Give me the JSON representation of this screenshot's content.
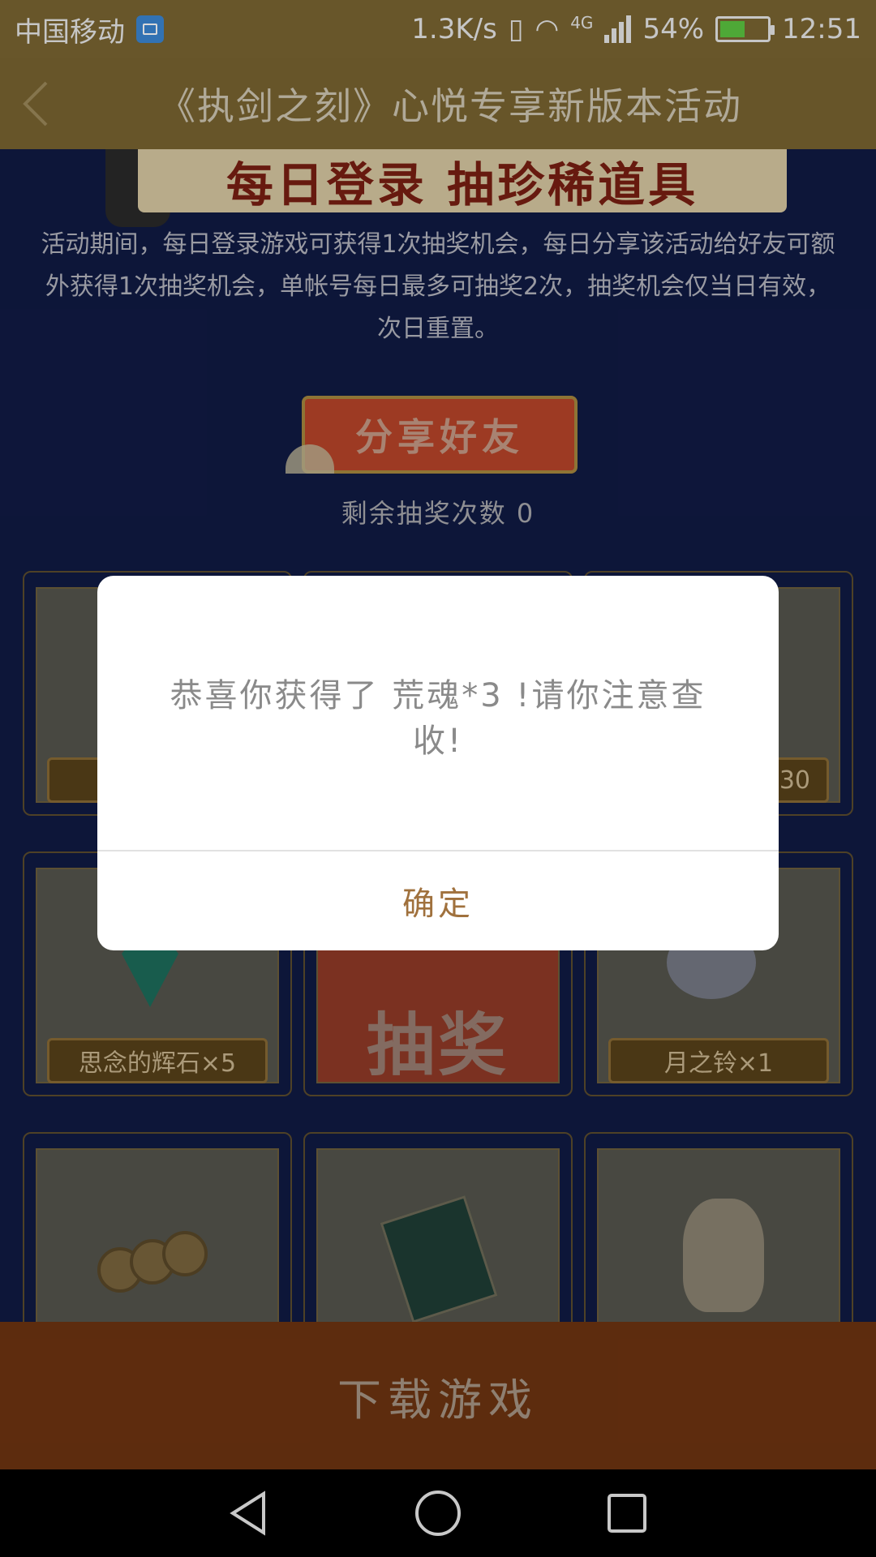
{
  "status_bar": {
    "carrier": "中国移动",
    "speed": "1.3K/s",
    "network_type": "4G",
    "battery_percent": "54%",
    "battery_level": 0.54,
    "time": "12:51"
  },
  "header": {
    "title": "《执剑之刻》心悦专享新版本活动"
  },
  "activity": {
    "banner_title": "每日登录 抽珍稀道具",
    "description": "活动期间，每日登录游戏可获得1次抽奖机会，每日分享该活动给好友可额外获得1次抽奖机会，单帐号每日最多可抽奖2次，抽奖机会仅当日有效，次日重置。",
    "share_button": "分享好友",
    "remaining_draws": "剩余抽奖次数 0"
  },
  "prizes": {
    "top_right_label": "30",
    "gem_label": "思念的辉石×5",
    "bell_label": "月之铃×1",
    "draw_label": "抽奖"
  },
  "dialog": {
    "message": "恭喜你获得了 荒魂*3 !请你注意查收!",
    "ok_button": "确定"
  },
  "download_bar": {
    "label": "下载游戏"
  },
  "colors": {
    "accent_gold": "#7a6431",
    "dialog_ok": "#a0713d",
    "download_bar": "#6e3411"
  }
}
